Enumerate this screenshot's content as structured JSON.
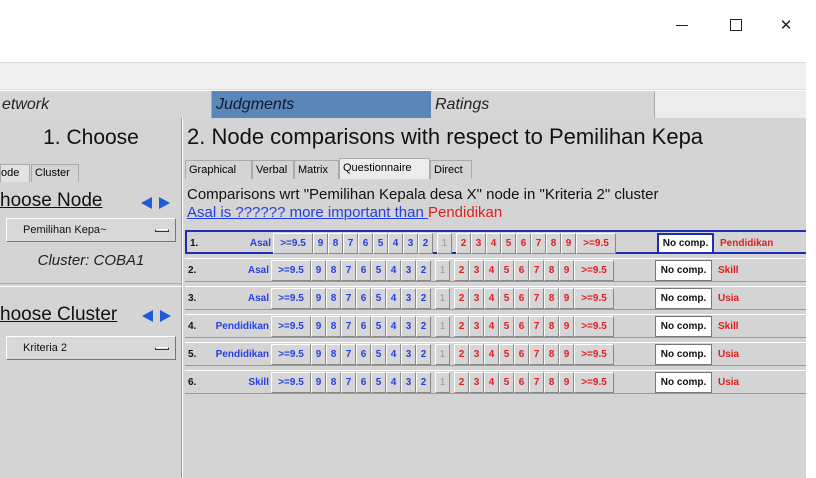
{
  "window": {
    "minimize_glyph": "",
    "maximize_glyph": "",
    "close_glyph": "✕"
  },
  "modes": {
    "network": "etwork",
    "judgments": "Judgments",
    "ratings": "Ratings"
  },
  "left": {
    "title": "1. Choose",
    "tabs": {
      "node": "ode",
      "cluster": "Cluster"
    },
    "choose_node": "hoose Node",
    "node_value": "Pemilihan Kepa~",
    "cluster_label": "Cluster: COBA1",
    "choose_cluster": "hoose Cluster",
    "cluster_value": "Kriteria 2"
  },
  "main": {
    "title": "2. Node comparisons with respect to Pemilihan Kepa",
    "tabs": [
      "Graphical",
      "Verbal",
      "Matrix",
      "Questionnaire",
      "Direct"
    ],
    "heading": "Comparisons wrt \"Pemilihan Kepala desa X\" node in \"Kriteria 2\" cluster",
    "question": {
      "left": "Asal",
      "middle": " is ?????? more important than ",
      "right": "Pendidikan"
    },
    "scale_left": [
      ">=9.5",
      "9",
      "8",
      "7",
      "6",
      "5",
      "4",
      "3",
      "2"
    ],
    "scale_mid": "1",
    "scale_right": [
      "2",
      "3",
      "4",
      "5",
      "6",
      "7",
      "8",
      "9",
      ">=9.5"
    ],
    "nocomp": "No comp.",
    "rows": [
      {
        "num": "1.",
        "left": "Asal",
        "right": "Pendidikan"
      },
      {
        "num": "2.",
        "left": "Asal",
        "right": "Skill"
      },
      {
        "num": "3.",
        "left": "Asal",
        "right": "Usia"
      },
      {
        "num": "4.",
        "left": "Pendidikan",
        "right": "Skill"
      },
      {
        "num": "5.",
        "left": "Pendidikan",
        "right": "Usia"
      },
      {
        "num": "6.",
        "left": "Skill",
        "right": "Usia"
      }
    ]
  }
}
